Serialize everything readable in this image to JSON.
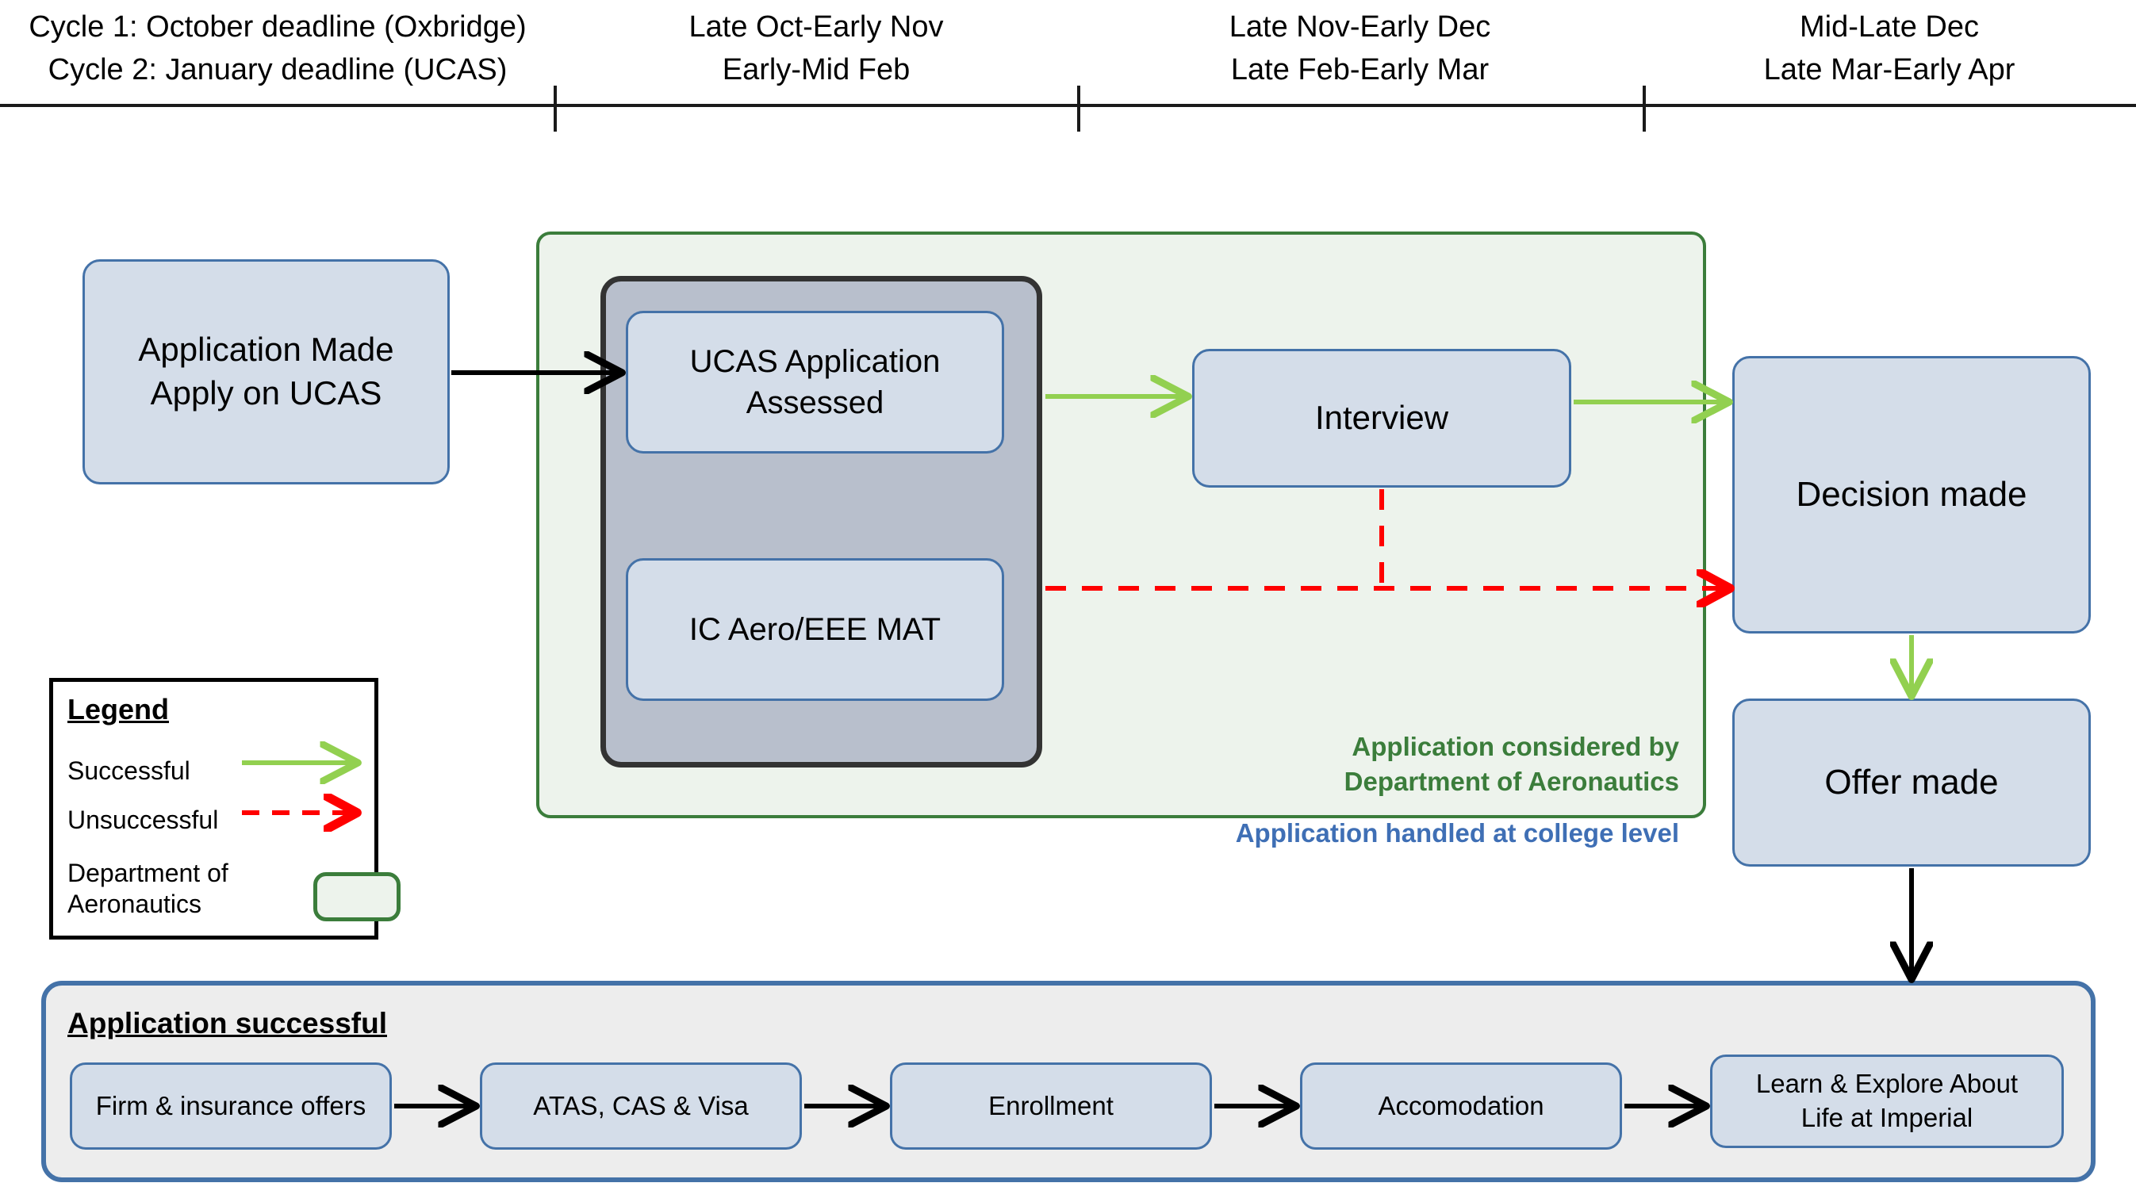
{
  "timeline": {
    "segments": [
      {
        "line1": "Cycle 1: October deadline (Oxbridge)",
        "line2": "Cycle 2: January deadline (UCAS)"
      },
      {
        "line1": "Late Oct-Early Nov",
        "line2": "Early-Mid Feb"
      },
      {
        "line1": "Late Nov-Early Dec",
        "line2": "Late Feb-Early Mar"
      },
      {
        "line1": "Mid-Late Dec",
        "line2": "Late Mar-Early Apr"
      }
    ]
  },
  "nodes": {
    "application_made": {
      "line1": "Application Made",
      "line2": "Apply on UCAS"
    },
    "ucas_assessed": {
      "line1": "UCAS Application",
      "line2": "Assessed"
    },
    "mat": {
      "line1": "IC Aero/EEE MAT"
    },
    "interview": {
      "line1": "Interview"
    },
    "decision_made": {
      "line1": "Decision made"
    },
    "offer_made": {
      "line1": "Offer made"
    }
  },
  "annotations": {
    "dept_note_line1": "Application considered by",
    "dept_note_line2": "Department of Aeronautics",
    "college_note": "Application handled at college level"
  },
  "legend": {
    "title": "Legend",
    "items": [
      {
        "label": "Successful",
        "marker": "solid-green-arrow"
      },
      {
        "label": "Unsuccessful",
        "marker": "dashed-red-arrow"
      },
      {
        "label_line1": "Department of",
        "label_line2": "Aeronautics",
        "marker": "green-rounded-box"
      }
    ]
  },
  "success_panel": {
    "title": "Application successful",
    "steps": [
      {
        "line1": "Firm & insurance offers"
      },
      {
        "line1": "ATAS, CAS & Visa"
      },
      {
        "line1": "Enrollment"
      },
      {
        "line1": "Accomodation"
      },
      {
        "line1": "Learn & Explore About",
        "line2": "Life at Imperial"
      }
    ]
  },
  "colors": {
    "node_fill": "#d4dde9",
    "node_border": "#4472a8",
    "dept_fill": "#edf3ec",
    "dept_border": "#3b7d3b",
    "grey_fill": "#b8bfcc",
    "grey_border": "#333333",
    "success_arrow": "#92d050",
    "fail_arrow": "#ff0000",
    "neutral_arrow": "#000000",
    "panel_fill": "#ededed",
    "college_text": "#3f6fb5"
  }
}
